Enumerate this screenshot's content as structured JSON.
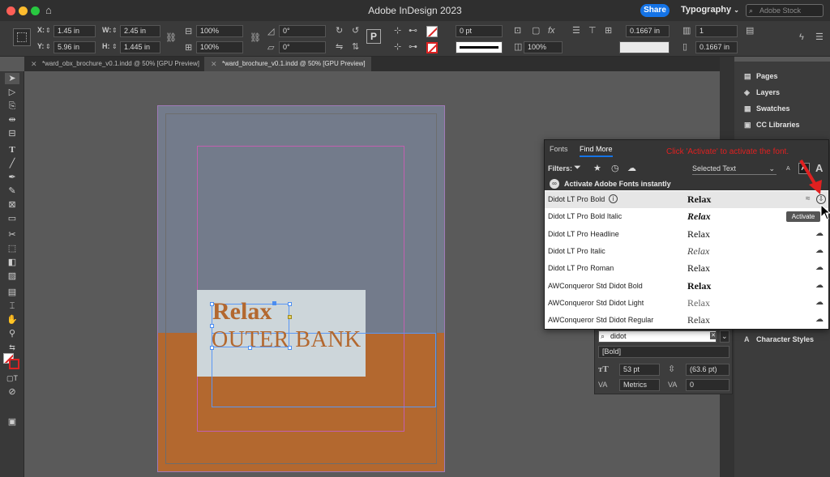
{
  "window": {
    "title": "Adobe InDesign 2023",
    "share_label": "Share",
    "workspace_label": "Typography",
    "stock_placeholder": "Adobe Stock"
  },
  "controlbar": {
    "x_label": "X:",
    "x_value": "1.45 in",
    "y_label": "Y:",
    "y_value": "5.96 in",
    "w_label": "W:",
    "w_value": "2.45 in",
    "h_label": "H:",
    "h_value": "1.445 in",
    "scale_x": "100%",
    "scale_y": "100%",
    "rotate": "0°",
    "shear": "0°",
    "stroke_weight": "0 pt",
    "opacity": "100%",
    "stroke_offset_1": "0.1667 in",
    "stroke_offset_2": "0.1667 in",
    "columns": "1",
    "gutter": "0.1667 in"
  },
  "tabs": [
    {
      "label": "*ward_obx_brochure_v0.1.indd @ 50% [GPU Preview]",
      "active": false
    },
    {
      "label": "*ward_brochure_v0.1.indd @ 50% [GPU Preview]",
      "active": true
    }
  ],
  "canvas": {
    "heading": "Relax",
    "subheading": "OUTER BANK"
  },
  "right_panels": {
    "items": [
      "Pages",
      "Layers",
      "Swatches",
      "CC Libraries"
    ],
    "character_styles": "Character Styles"
  },
  "font_popup": {
    "tab_fonts": "Fonts",
    "tab_find_more": "Find More",
    "instruction": "Click 'Activate' to activate the font.",
    "filters_label": "Filters:",
    "sample_select": "Selected Text",
    "activate_banner": "Activate Adobe Fonts instantly",
    "activate_tooltip": "Activate",
    "fonts": [
      {
        "name": "Didot LT Pro Bold",
        "preview": "Relax",
        "style": "bold"
      },
      {
        "name": "Didot LT Pro Bold Italic",
        "preview": "Relax",
        "style": "bolditalic"
      },
      {
        "name": "Didot LT Pro Headline",
        "preview": "Relax",
        "style": "normal"
      },
      {
        "name": "Didot LT Pro Italic",
        "preview": "Relax",
        "style": "italic"
      },
      {
        "name": "Didot LT Pro Roman",
        "preview": "Relax",
        "style": "normal"
      },
      {
        "name": "AWConqueror Std Didot Bold",
        "preview": "Relax",
        "style": "bold"
      },
      {
        "name": "AWConqueror Std Didot Light",
        "preview": "Relax",
        "style": "light"
      },
      {
        "name": "AWConqueror Std Didot Regular",
        "preview": "Relax",
        "style": "normal"
      }
    ]
  },
  "character_panel": {
    "font_search": "didot",
    "font_style": "[Bold]",
    "font_size": "53 pt",
    "leading": "(63.6 pt)",
    "kerning": "Metrics",
    "tracking": "0"
  },
  "colors": {
    "accent": "#1473e6",
    "page_blue": "#737b8b",
    "page_orange": "#b3682f",
    "instruction_red": "#e02020"
  }
}
